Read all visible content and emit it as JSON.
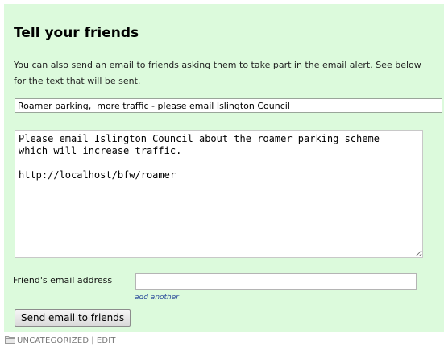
{
  "section": {
    "title": "Tell your friends",
    "intro": "You can also send an email to friends asking them to take part in the email alert. See below for the text that will be sent."
  },
  "form": {
    "subject_value": "Roamer parking,  more traffic - please email Islington Council",
    "body_value": "Please email Islington Council about the roamer parking scheme\nwhich will increase traffic.\n\nhttp://localhost/bfw/roamer",
    "email_label": "Friend's email address",
    "email_value": "",
    "add_another_label": "add another",
    "send_button_label": "Send email to friends"
  },
  "footer": {
    "icon": "folder-icon",
    "category_label": "UNCATEGORIZED",
    "separator": "|",
    "edit_label": "EDIT"
  },
  "colors": {
    "panel_background": "#dcfadc",
    "link": "#2a4b9a",
    "footer_text": "#777777"
  }
}
